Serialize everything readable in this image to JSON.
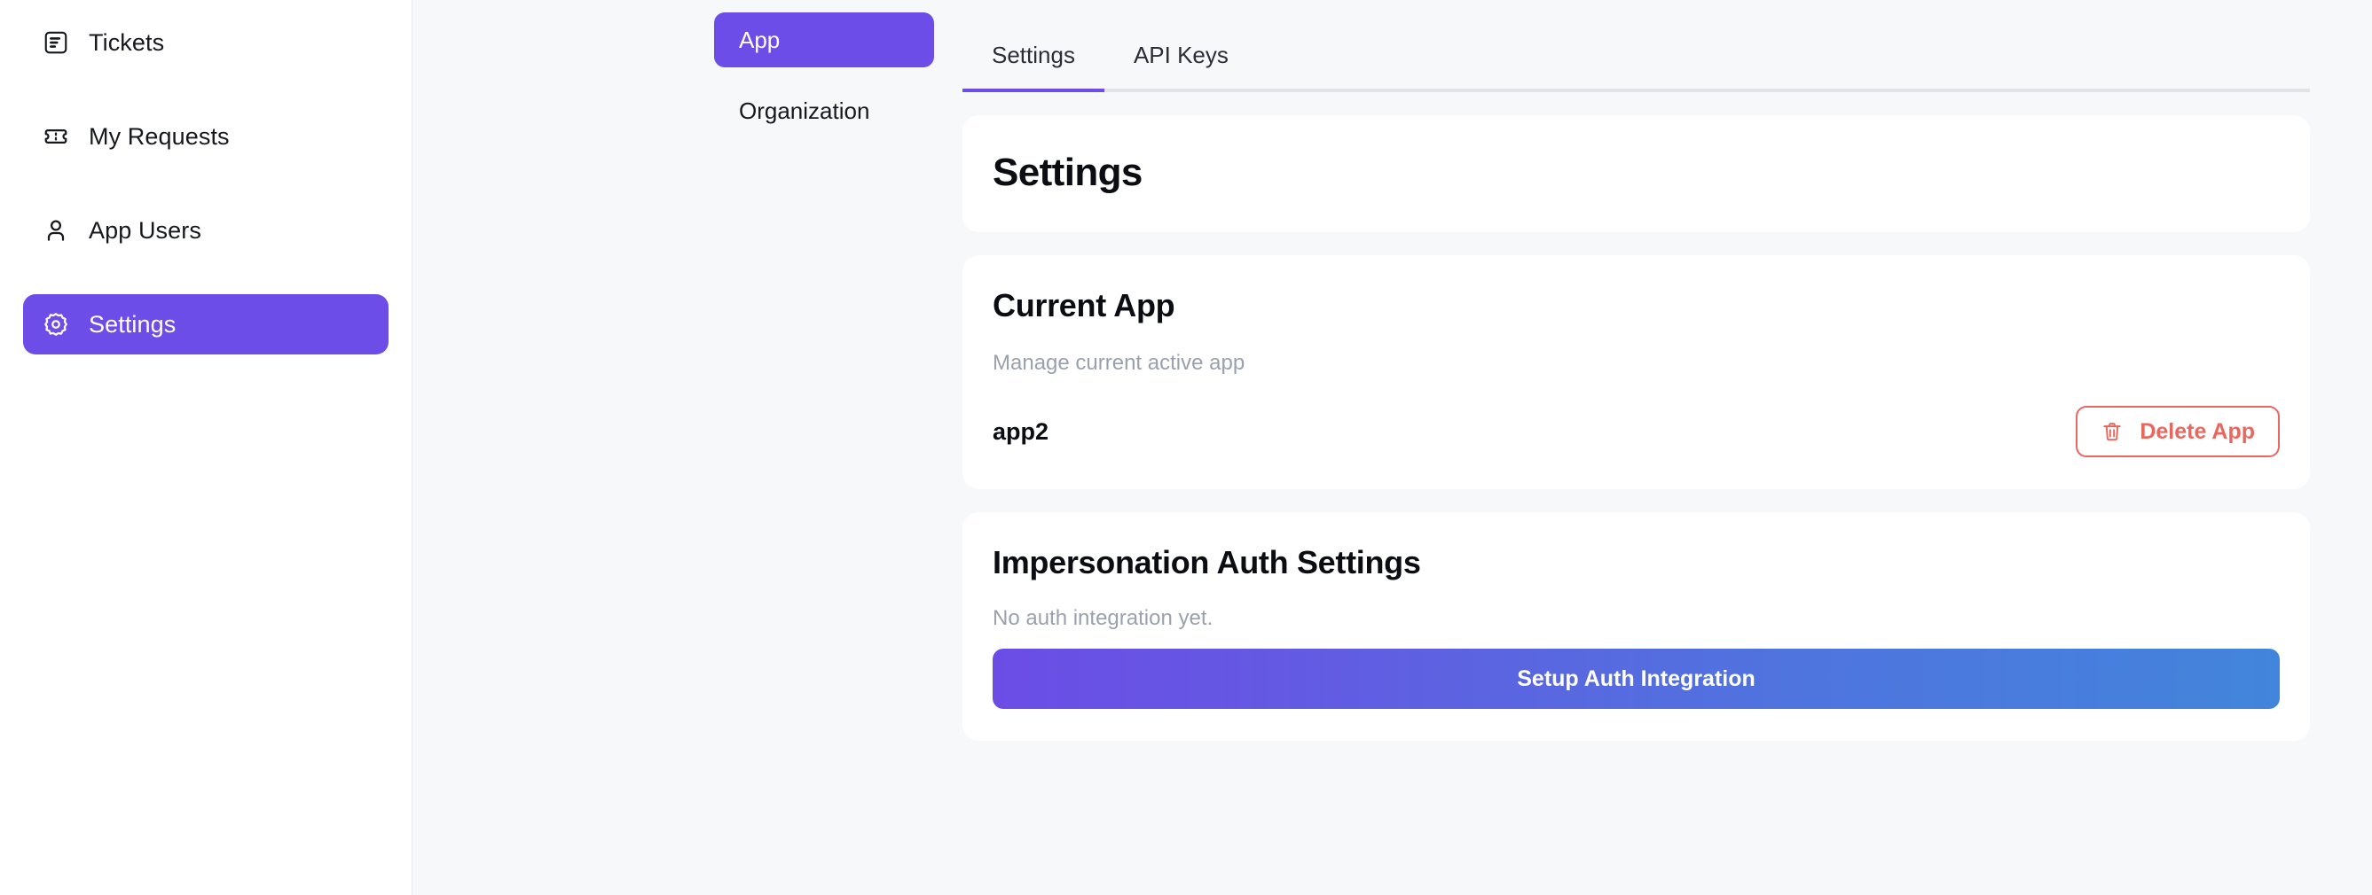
{
  "sidebar": {
    "items": [
      {
        "label": "Tickets",
        "icon": "ticket-document-icon",
        "active": false
      },
      {
        "label": "My Requests",
        "icon": "ticket-icon",
        "active": false
      },
      {
        "label": "App Users",
        "icon": "user-icon",
        "active": false
      },
      {
        "label": "Settings",
        "icon": "gear-icon",
        "active": true
      }
    ]
  },
  "scope_nav": {
    "items": [
      {
        "label": "App",
        "active": true
      },
      {
        "label": "Organization",
        "active": false
      }
    ]
  },
  "tabs": [
    {
      "label": "Settings",
      "active": true
    },
    {
      "label": "API Keys",
      "active": false
    }
  ],
  "page": {
    "title": "Settings"
  },
  "current_app": {
    "title": "Current App",
    "subtitle": "Manage current active app",
    "app_name": "app2",
    "delete_button": "Delete App",
    "delete_icon": "trash-icon"
  },
  "impersonation": {
    "title": "Impersonation Auth Settings",
    "empty_text": "No auth integration yet.",
    "setup_button": "Setup Auth Integration"
  },
  "colors": {
    "accent_purple": "#6C4DE8",
    "gradient_start": "#6B4DE6",
    "gradient_end": "#4285DC",
    "danger_red": "#E8675E",
    "page_bg": "#F7F8FA",
    "card_bg": "#FFFFFF",
    "muted_text": "#9AA1AD",
    "divider": "#E6E8EE"
  }
}
